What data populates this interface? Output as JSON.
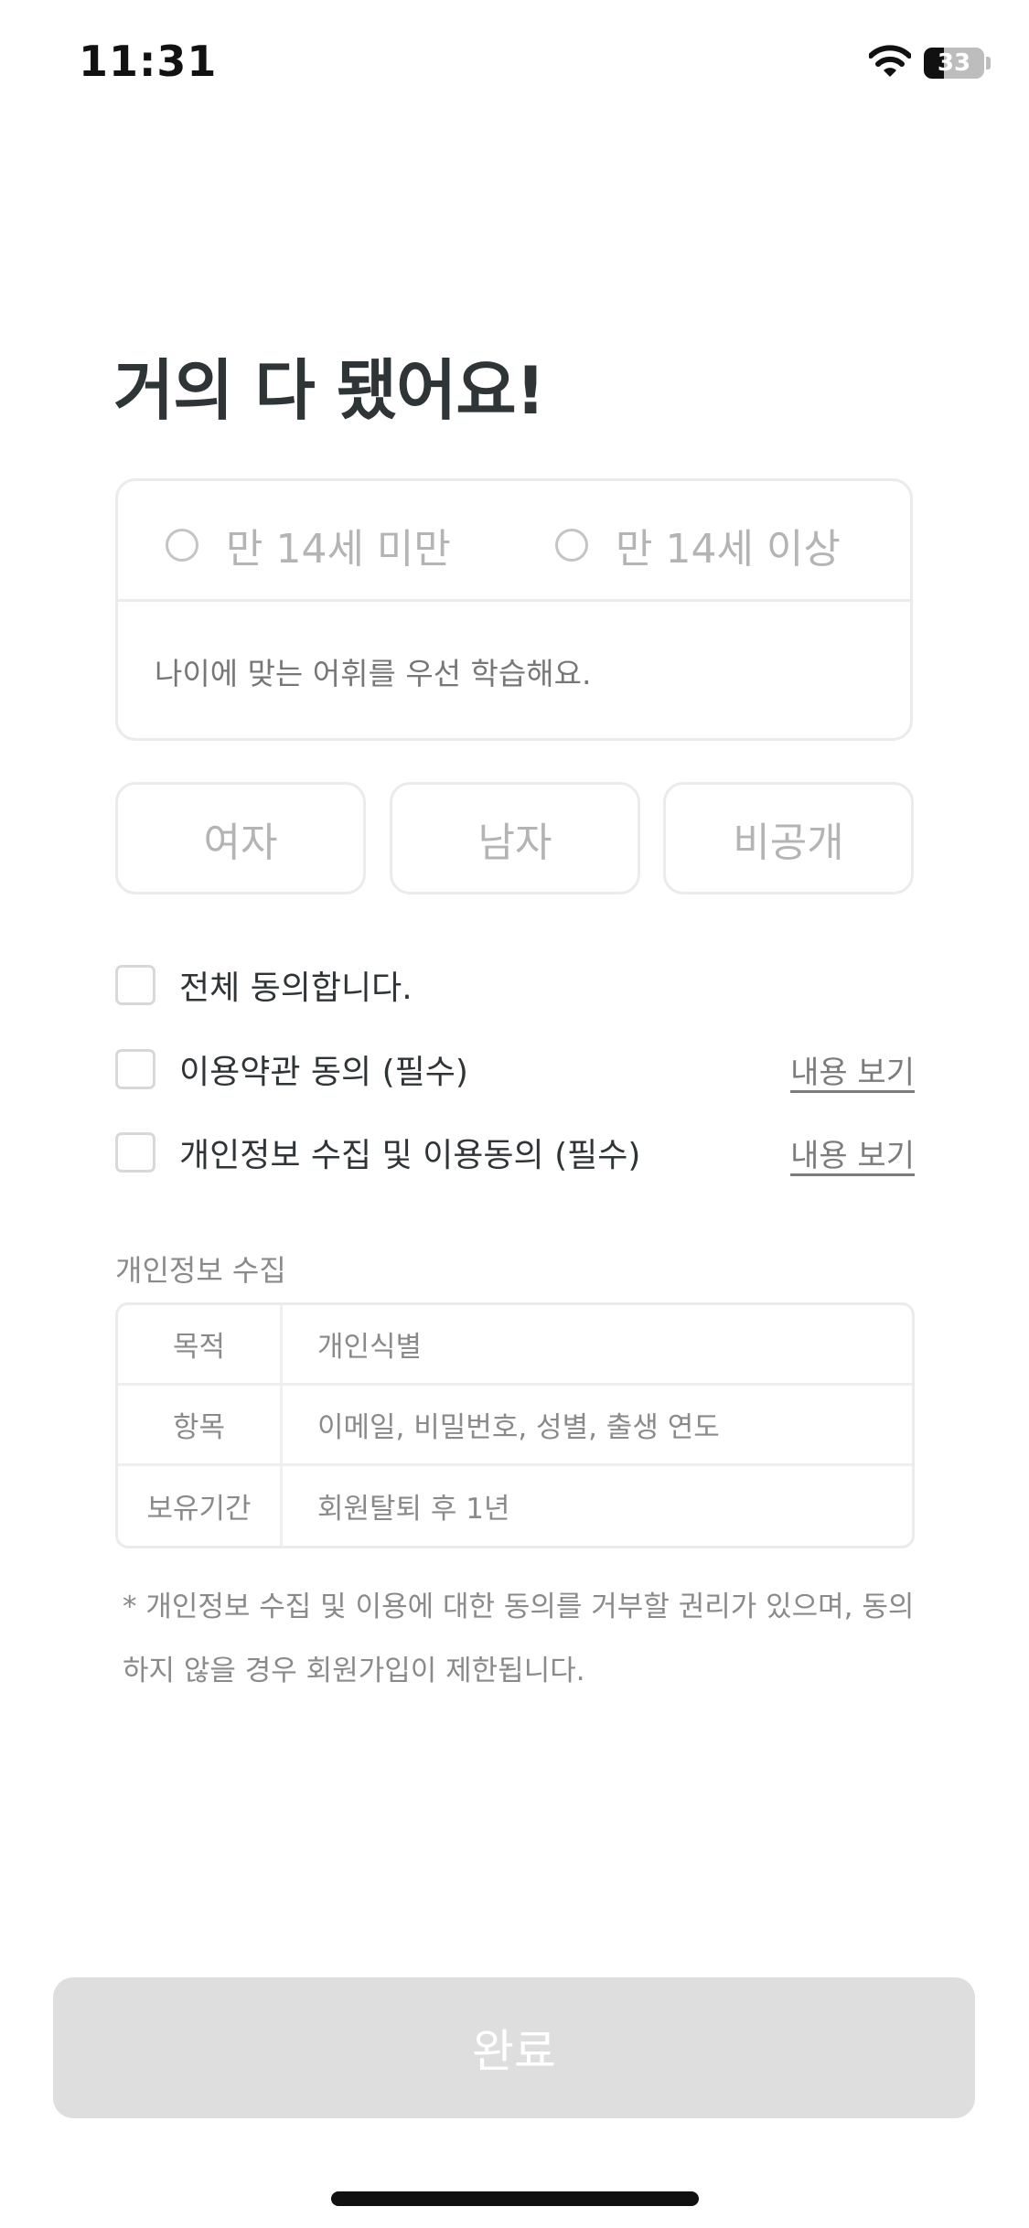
{
  "status_bar": {
    "time": "11:31",
    "battery_percent": "33",
    "battery_level": 0.33
  },
  "title": "거의 다 됐어요!",
  "age": {
    "options": [
      "만 14세 미만",
      "만 14세 이상"
    ],
    "hint": "나이에 맞는 어휘를 우선 학습해요."
  },
  "gender": {
    "options": [
      "여자",
      "남자",
      "비공개"
    ]
  },
  "agreements": {
    "all": "전체 동의합니다.",
    "terms": "이용약관 동의 (필수)",
    "privacy": "개인정보 수집 및 이용동의 (필수)",
    "view_link": "내용 보기"
  },
  "privacy": {
    "section_label": "개인정보 수집",
    "rows": [
      {
        "key": "목적",
        "value": "개인식별"
      },
      {
        "key": "항목",
        "value": "이메일, 비밀번호, 성별, 출생 연도"
      },
      {
        "key": "보유기간",
        "value": "회원탈퇴 후 1년"
      }
    ],
    "footnote": "* 개인정보 수집 및 이용에 대한 동의를 거부할 권리가 있으며, 동의하지 않을 경우 회원가입이 제한됩니다."
  },
  "complete_button": "완료",
  "colors": {
    "title": "#2f3437",
    "border": "#ebebeb",
    "muted_text": "#8a8a8a",
    "button_disabled": "#dedede"
  }
}
